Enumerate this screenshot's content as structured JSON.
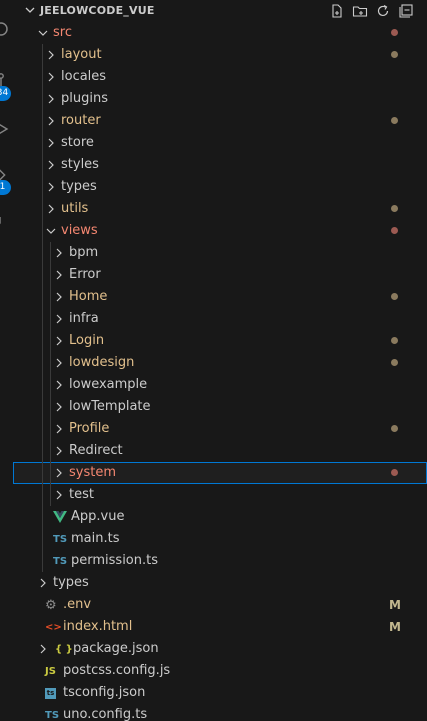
{
  "explorer": {
    "title": "JEELOWCODE_VUE",
    "actions": [
      "new-file-icon",
      "new-folder-icon",
      "refresh-icon",
      "collapse-all-icon"
    ]
  },
  "activity_badges": [
    "34",
    "1"
  ],
  "colors": {
    "modified_folder": "#e2c08d",
    "error_folder": "#f48771",
    "dot_modified": "#8a7a5e",
    "dot_error": "#9c5a52",
    "m_badge": "#c2b78e"
  },
  "tree": [
    {
      "label": "src",
      "depth": 0,
      "expanded": true,
      "color": "#f48771",
      "dot": "#9c5a52"
    },
    {
      "label": "layout",
      "depth": 1,
      "color": "#e2c08d",
      "dot": "#8a7a5e"
    },
    {
      "label": "locales",
      "depth": 1
    },
    {
      "label": "plugins",
      "depth": 1
    },
    {
      "label": "router",
      "depth": 1,
      "color": "#e2c08d",
      "dot": "#8a7a5e"
    },
    {
      "label": "store",
      "depth": 1
    },
    {
      "label": "styles",
      "depth": 1
    },
    {
      "label": "types",
      "depth": 1
    },
    {
      "label": "utils",
      "depth": 1,
      "color": "#e2c08d",
      "dot": "#8a7a5e"
    },
    {
      "label": "views",
      "depth": 1,
      "expanded": true,
      "color": "#f48771",
      "dot": "#9c5a52"
    },
    {
      "label": "bpm",
      "depth": 2
    },
    {
      "label": "Error",
      "depth": 2
    },
    {
      "label": "Home",
      "depth": 2,
      "color": "#e2c08d",
      "dot": "#8a7a5e"
    },
    {
      "label": "infra",
      "depth": 2
    },
    {
      "label": "Login",
      "depth": 2,
      "color": "#e2c08d",
      "dot": "#8a7a5e"
    },
    {
      "label": "lowdesign",
      "depth": 2,
      "color": "#e2c08d",
      "dot": "#8a7a5e"
    },
    {
      "label": "lowexample",
      "depth": 2
    },
    {
      "label": "lowTemplate",
      "depth": 2
    },
    {
      "label": "Profile",
      "depth": 2,
      "color": "#e2c08d",
      "dot": "#8a7a5e"
    },
    {
      "label": "Redirect",
      "depth": 2
    },
    {
      "label": "system",
      "depth": 2,
      "color": "#f48771",
      "dot": "#9c5a52",
      "selected": true
    },
    {
      "label": "test",
      "depth": 2
    },
    {
      "label": "App.vue",
      "depth": 1,
      "file": "vue"
    },
    {
      "label": "main.ts",
      "depth": 1,
      "file": "ts"
    },
    {
      "label": "permission.ts",
      "depth": 1,
      "file": "ts"
    },
    {
      "label": "types",
      "depth": 0
    },
    {
      "label": ".env",
      "depth": 0,
      "file": "gear",
      "color": "#e2c08d",
      "badge": "M"
    },
    {
      "label": "index.html",
      "depth": 0,
      "file": "html",
      "color": "#e2c08d",
      "badge": "M"
    },
    {
      "label": "package.json",
      "depth": 0,
      "file": "json",
      "folderlike": true
    },
    {
      "label": "postcss.config.js",
      "depth": 0,
      "file": "js"
    },
    {
      "label": "tsconfig.json",
      "depth": 0,
      "file": "tsjson"
    },
    {
      "label": "uno.config.ts",
      "depth": 0,
      "file": "ts"
    }
  ]
}
